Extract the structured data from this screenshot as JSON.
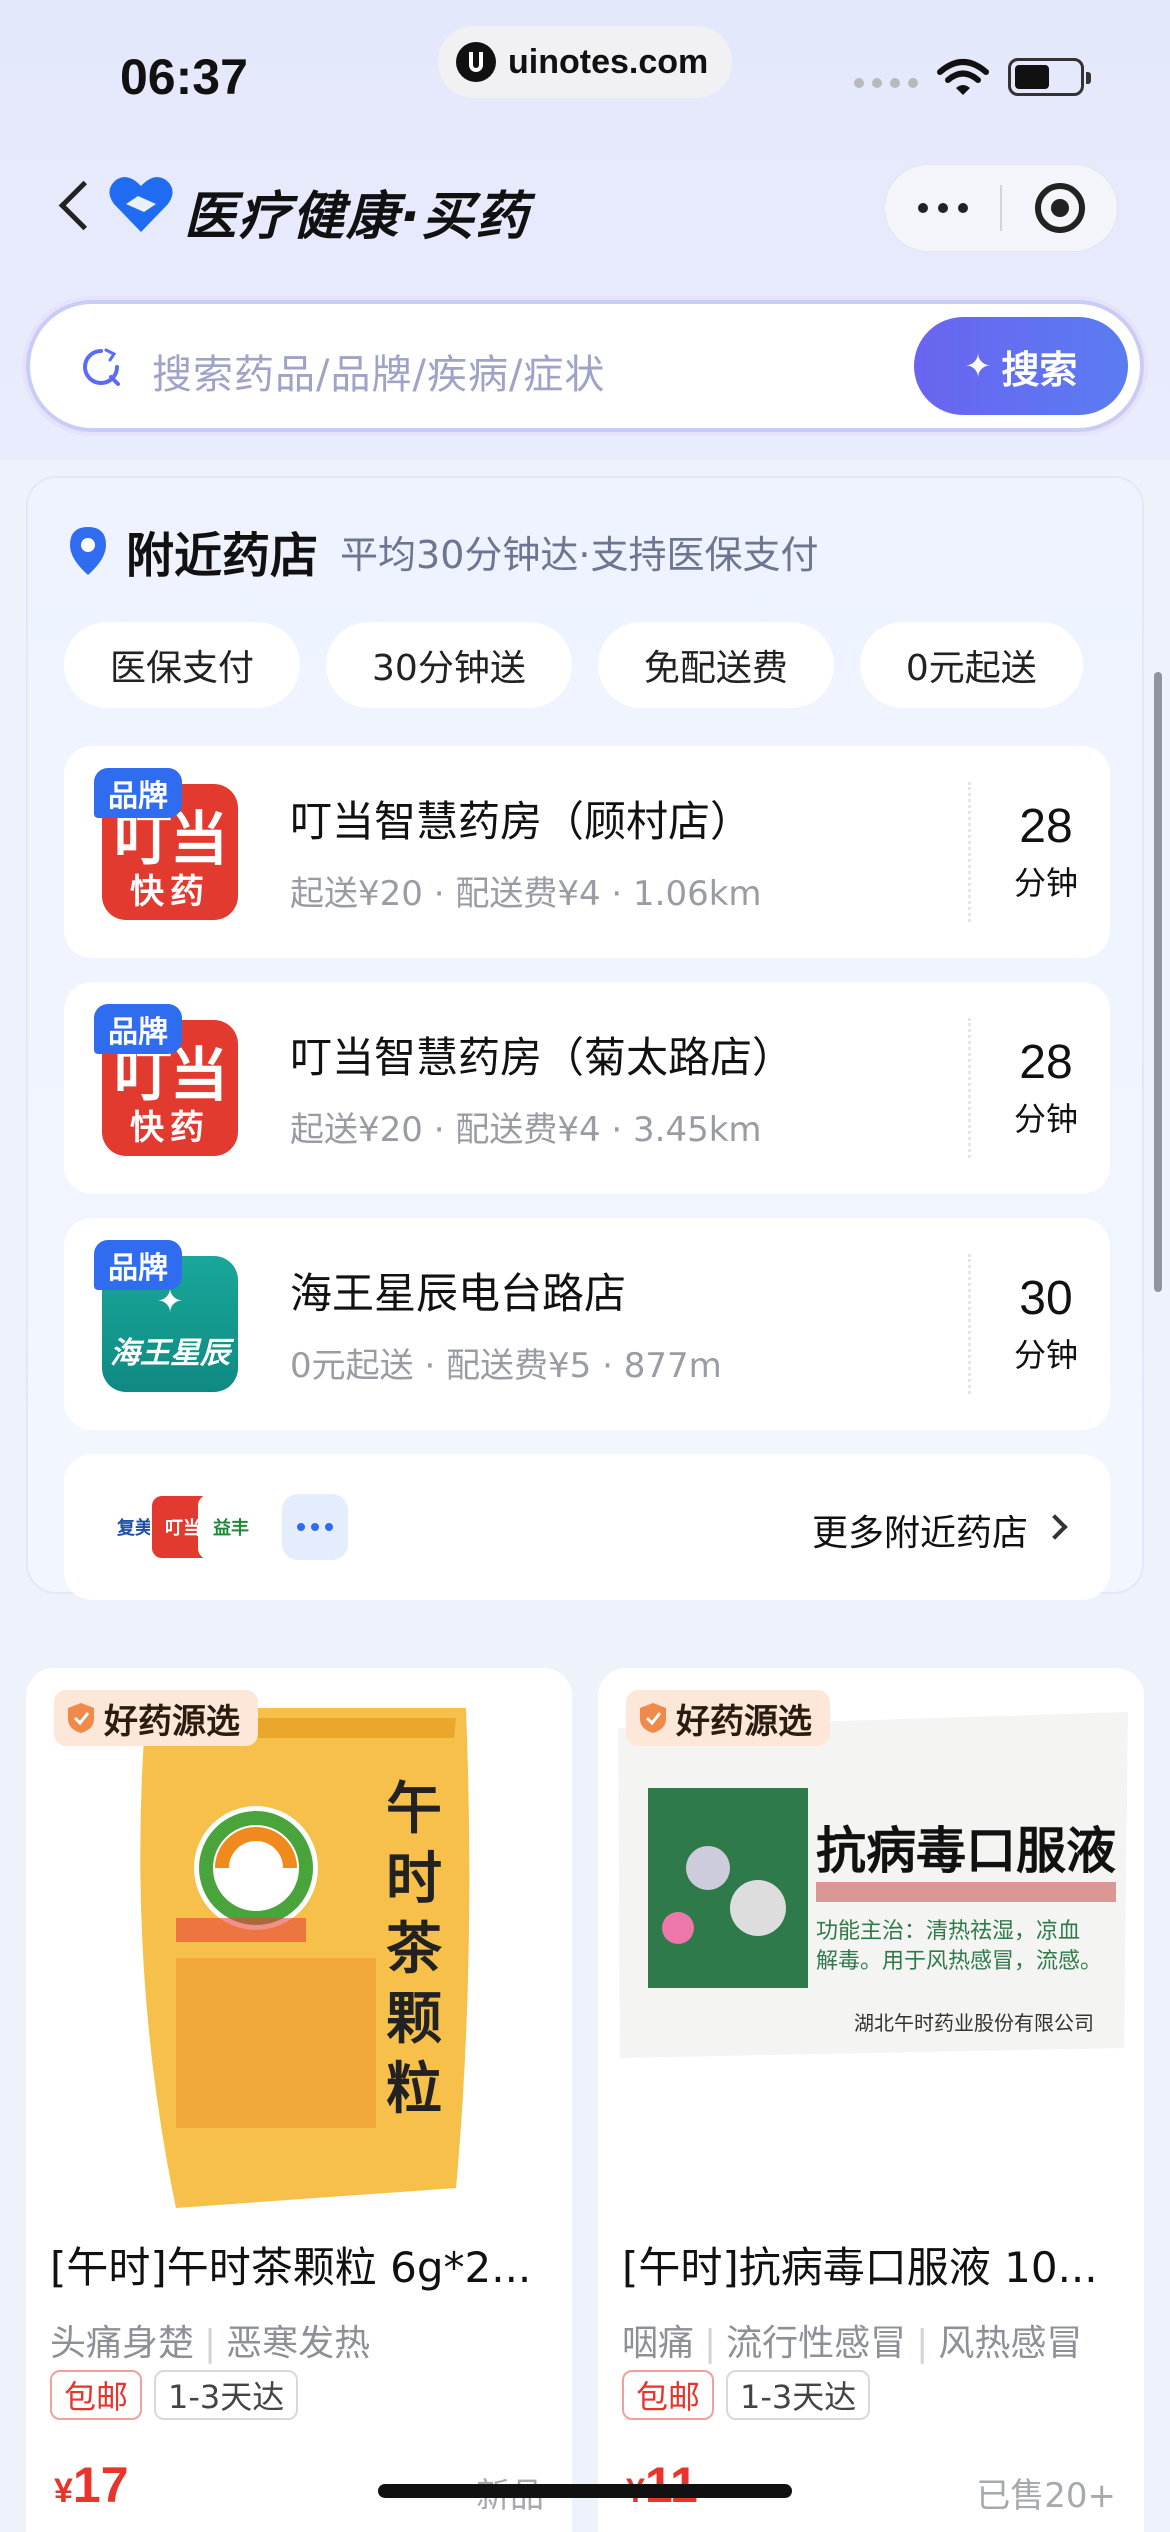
{
  "status_bar": {
    "time": "06:37",
    "url": "uinotes.com"
  },
  "nav": {
    "title": "医疗健康·买药",
    "back_icon": "chevron-left-icon",
    "more_icon": "more-dots-icon",
    "target_icon": "target-icon"
  },
  "search": {
    "placeholder": "搜索药品/品牌/疾病/症状",
    "button_label": "搜索"
  },
  "nearby": {
    "title": "附近药店",
    "subtitle": "平均30分钟达·支持医保支付",
    "tags": [
      "医保支付",
      "30分钟送",
      "免配送费",
      "0元起送"
    ],
    "stores": [
      {
        "badge": "品牌",
        "logo_line1": "叮当",
        "logo_line2": "快药",
        "name": "叮当智慧药房（顾村店）",
        "meta": "起送¥20 · 配送费¥4 · 1.06km",
        "time": "28",
        "unit": "分钟"
      },
      {
        "badge": "品牌",
        "logo_line1": "叮当",
        "logo_line2": "快药",
        "name": "叮当智慧药房（菊太路店）",
        "meta": "起送¥20 · 配送费¥4 · 3.45km",
        "time": "28",
        "unit": "分钟"
      },
      {
        "badge": "品牌",
        "logo_line1": "✦",
        "logo_line2": "海王星辰",
        "name": "海王星辰电台路店",
        "meta": "0元起送 · 配送费¥5 · 877m",
        "time": "30",
        "unit": "分钟"
      }
    ],
    "more_label": "更多附近药店",
    "mini_logos": [
      "复美",
      "叮当",
      "益丰"
    ]
  },
  "products": [
    {
      "tag": "好药源选",
      "box_brand": "午时",
      "box_text": "午时茶颗粒",
      "title": "[午时]午时茶颗粒 6g*2...",
      "symptoms": [
        "头痛身楚",
        "恶寒发热"
      ],
      "label_free": "包邮",
      "label_delivery": "1-3天达",
      "currency": "¥",
      "price": "17",
      "sold": "新品"
    },
    {
      "tag": "好药源选",
      "box_brand": "午时",
      "box_text": "抗病毒口服液",
      "title": "[午时]抗病毒口服液 10...",
      "symptoms": [
        "咽痛",
        "流行性感冒",
        "风热感冒"
      ],
      "label_free": "包邮",
      "label_delivery": "1-3天达",
      "currency": "¥",
      "price": "11",
      "sold": "已售20+"
    }
  ],
  "colors": {
    "accent": "#5a6cf2",
    "price": "#e9342c",
    "brand_blue": "#2f6cf0"
  }
}
